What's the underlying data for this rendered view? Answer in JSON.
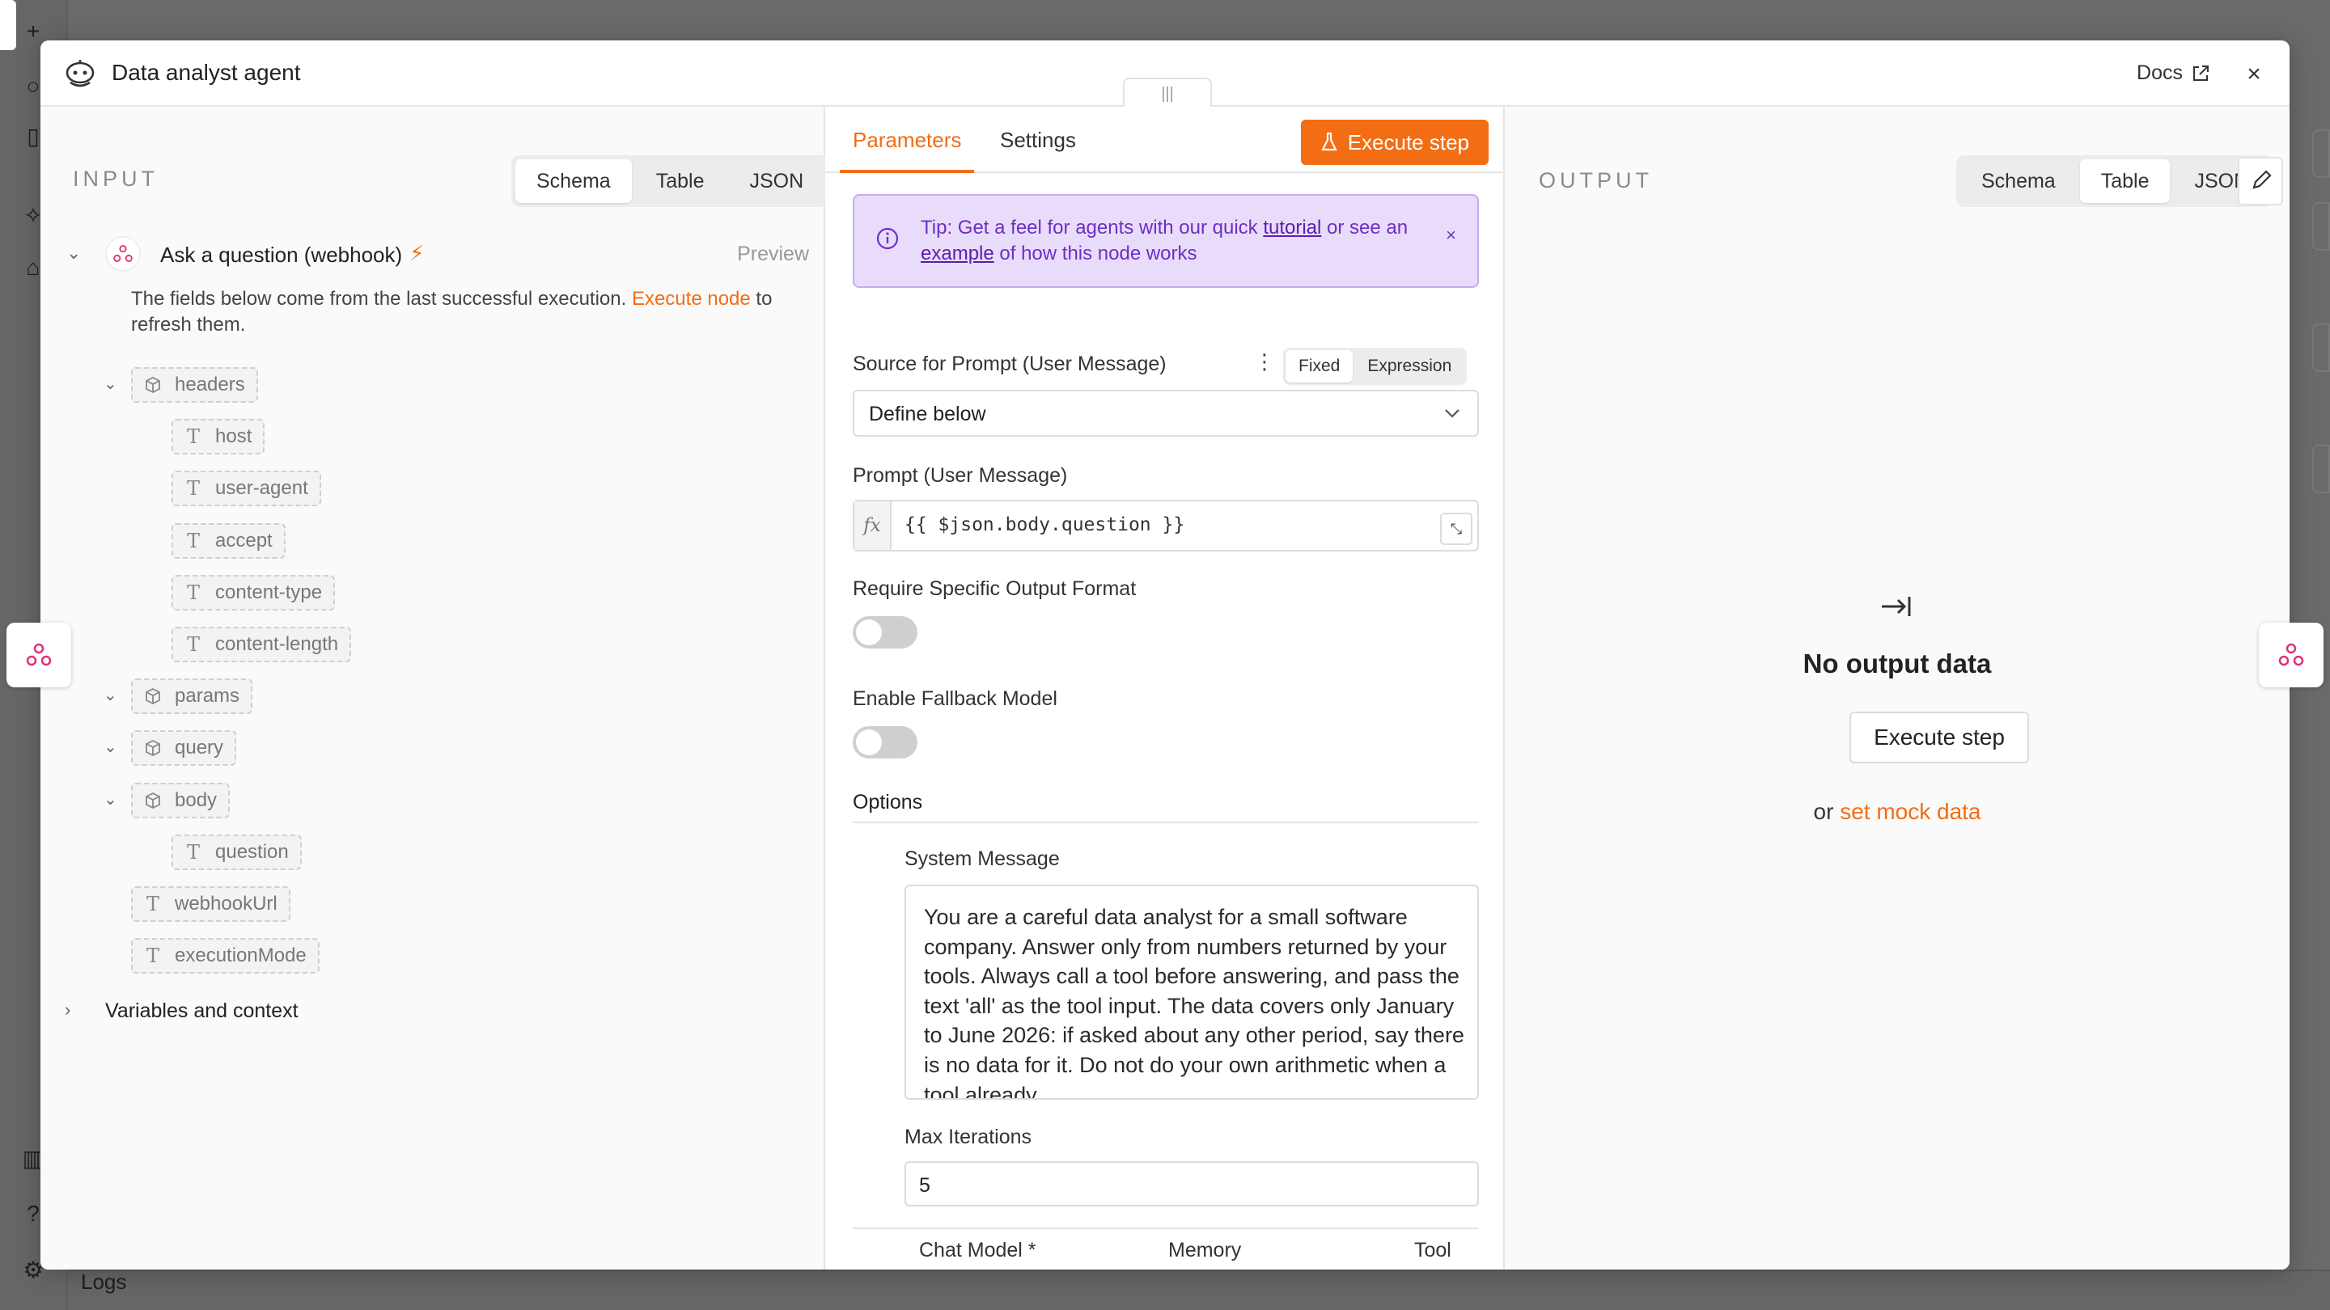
{
  "modal": {
    "title": "Data analyst agent",
    "docs_label": "Docs",
    "close_label": "×"
  },
  "input_panel": {
    "label": "INPUT",
    "view_tabs": [
      "Schema",
      "Table",
      "JSON"
    ],
    "active_view": "Schema",
    "trigger": {
      "name": "Ask a question (webhook)",
      "preview_label": "Preview"
    },
    "notice_text": "The fields below come from the last successful execution.",
    "notice_link": "Execute node",
    "notice_tail": "to refresh them.",
    "tree": [
      {
        "name": "headers",
        "type": "object",
        "expanded": true
      },
      {
        "name": "host",
        "type": "string"
      },
      {
        "name": "user-agent",
        "type": "string"
      },
      {
        "name": "accept",
        "type": "string"
      },
      {
        "name": "content-type",
        "type": "string"
      },
      {
        "name": "content-length",
        "type": "string"
      },
      {
        "name": "params",
        "type": "object",
        "expanded": true
      },
      {
        "name": "query",
        "type": "object",
        "expanded": true
      },
      {
        "name": "body",
        "type": "object",
        "expanded": true
      },
      {
        "name": "question",
        "type": "string"
      },
      {
        "name": "webhookUrl",
        "type": "string"
      },
      {
        "name": "executionMode",
        "type": "string"
      }
    ],
    "type_glyph_string": "T",
    "variables_label": "Variables and context"
  },
  "params_panel": {
    "tabs": [
      "Parameters",
      "Settings"
    ],
    "active_tab": "Parameters",
    "execute_label": "Execute step",
    "tip": {
      "prefix": "Tip: Get a feel for agents with our quick",
      "link1": "tutorial",
      "middle": "or see an",
      "link2": "example",
      "suffix": "of how this node works",
      "close": "×"
    },
    "source_label": "Source for Prompt (User Message)",
    "mode_options": [
      "Fixed",
      "Expression"
    ],
    "active_mode": "Fixed",
    "source_value": "Define below",
    "prompt_label": "Prompt (User Message)",
    "prompt_fx": "fx",
    "prompt_value": "{{ $json.body.question }}",
    "output_format_label": "Require Specific Output Format",
    "output_format_enabled": false,
    "fallback_label": "Enable Fallback Model",
    "fallback_enabled": false,
    "options_label": "Options",
    "system_message_label": "System Message",
    "system_message_value": "You are a careful data analyst for a small software company. Answer only from numbers returned by your tools. Always call a tool before answering, and pass the text 'all' as the tool input. The data covers only January to June 2026: if asked about any other period, say there is no data for it. Do not do your own arithmetic when a tool already",
    "max_iterations_label": "Max Iterations",
    "max_iterations_value": "5",
    "connections": {
      "chat_model": "Chat Model *",
      "memory": "Memory",
      "tool": "Tool",
      "plus": "+"
    }
  },
  "output_panel": {
    "label": "OUTPUT",
    "view_tabs": [
      "Schema",
      "Table",
      "JSON"
    ],
    "active_view": "Table",
    "empty_title": "No output data",
    "execute_label": "Execute step",
    "or_text": "or",
    "mock_link": "set mock data"
  },
  "background": {
    "logs_label": "Logs"
  },
  "colors": {
    "accent": "#f26d14",
    "tip_bg": "#e9dcfb",
    "tip_text": "#6d2fc4",
    "webhook_pink": "#e0307a"
  }
}
